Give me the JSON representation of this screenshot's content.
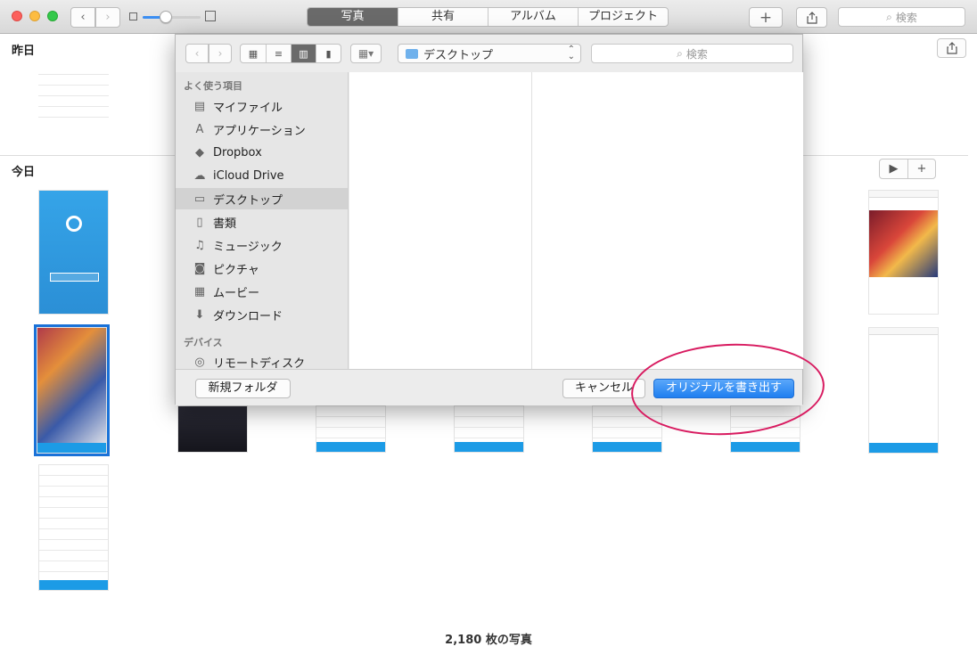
{
  "toolbar": {
    "segments": [
      "写真",
      "共有",
      "アルバム",
      "プロジェクト"
    ],
    "active_segment": "写真",
    "add_label": "+",
    "search_placeholder": "検索",
    "zoom_level": 0.4
  },
  "sections": {
    "yesterday": "昨日",
    "today": "今日"
  },
  "footer": {
    "photo_count": "2,180 枚の写真"
  },
  "dialog": {
    "location": "デスクトップ",
    "search_placeholder": "検索",
    "favorites_header": "よく使う項目",
    "favorites": [
      {
        "label": "マイファイル",
        "icon": "all-files-icon"
      },
      {
        "label": "アプリケーション",
        "icon": "applications-icon"
      },
      {
        "label": "Dropbox",
        "icon": "dropbox-icon"
      },
      {
        "label": "iCloud Drive",
        "icon": "cloud-icon"
      },
      {
        "label": "デスクトップ",
        "icon": "desktop-icon",
        "selected": true
      },
      {
        "label": "書類",
        "icon": "documents-icon"
      },
      {
        "label": "ミュージック",
        "icon": "music-icon"
      },
      {
        "label": "ピクチャ",
        "icon": "camera-icon"
      },
      {
        "label": "ムービー",
        "icon": "film-icon"
      },
      {
        "label": "ダウンロード",
        "icon": "download-icon"
      }
    ],
    "devices_header": "デバイス",
    "devices": [
      {
        "label": "リモートディスク",
        "icon": "disc-icon"
      }
    ],
    "new_folder_label": "新規フォルダ",
    "cancel_label": "キャンセル",
    "export_label": "オリジナルを書き出す"
  },
  "colors": {
    "accent": "#1f7ff0",
    "annotation": "#d81b60",
    "selection": "#1a72d8"
  }
}
